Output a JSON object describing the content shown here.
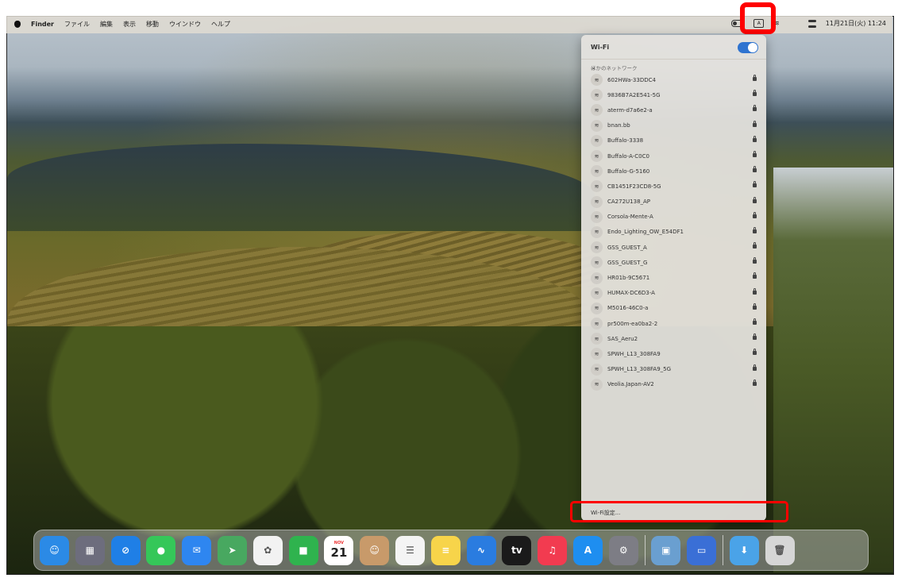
{
  "menubar": {
    "app_name": "Finder",
    "menus": [
      "ファイル",
      "編集",
      "表示",
      "移動",
      "ウインドウ",
      "ヘルプ"
    ],
    "input_indicator": "A",
    "datetime": "11月21日(火) 11:24"
  },
  "wifi_panel": {
    "title": "Wi-Fi",
    "toggle_on": true,
    "section_label": "ほかのネットワーク",
    "networks": [
      "602HWa-33DDC4",
      "9836B7A2E541-5G",
      "aterm-d7a6e2-a",
      "bnan.bb",
      "Buffalo-3338",
      "Buffalo-A-C0C0",
      "Buffalo-G-5160",
      "CB1451F23CD8-5G",
      "CA272U138_AP",
      "Corsola-Mente-A",
      "Endo_Lighting_OW_E54DF1",
      "GSS_GUEST_A",
      "GSS_GUEST_G",
      "HR01b-9C5671",
      "HUMAX-DC6D3-A",
      "M5016-46C0-a",
      "pr500m-ea0ba2-2",
      "SAS_Aeru2",
      "SPWH_L13_308FA9",
      "SPWH_L13_308FA9_5G",
      "Veolia.Japan-AV2"
    ],
    "settings_label": "Wi-Fi設定..."
  },
  "dock": {
    "apps": [
      {
        "name": "finder",
        "color": "#2b8ae6",
        "glyph": "☺"
      },
      {
        "name": "launchpad",
        "color": "#6d6d7d",
        "glyph": "▦"
      },
      {
        "name": "safari",
        "color": "#1f7fe6",
        "glyph": "⊘"
      },
      {
        "name": "messages",
        "color": "#35c759",
        "glyph": "●"
      },
      {
        "name": "mail",
        "color": "#2e86f0",
        "glyph": "✉"
      },
      {
        "name": "maps",
        "color": "#48a860",
        "glyph": "➤"
      },
      {
        "name": "photos",
        "color": "#f2f2f2",
        "glyph": "✿"
      },
      {
        "name": "facetime",
        "color": "#2fb34e",
        "glyph": "■"
      },
      {
        "name": "calendar",
        "color": "#ffffff",
        "glyph": "21",
        "month": "NOV"
      },
      {
        "name": "contacts",
        "color": "#c89a6a",
        "glyph": "☺"
      },
      {
        "name": "reminders",
        "color": "#f4f4f4",
        "glyph": "☰"
      },
      {
        "name": "notes",
        "color": "#f7d44a",
        "glyph": "≡"
      },
      {
        "name": "freeform",
        "color": "#2a7ce0",
        "glyph": "∿"
      },
      {
        "name": "apple-tv",
        "color": "#1a1a1a",
        "glyph": "tv"
      },
      {
        "name": "music",
        "color": "#f23b50",
        "glyph": "♫"
      },
      {
        "name": "app-store",
        "color": "#1e8ef0",
        "glyph": "A"
      },
      {
        "name": "system-settings",
        "color": "#7d7d85",
        "glyph": "⚙"
      },
      {
        "name": "preview",
        "color": "#6a9fd0",
        "glyph": "▣"
      },
      {
        "name": "screen-sharing",
        "color": "#3a6fd6",
        "glyph": "▭"
      },
      {
        "name": "downloads-folder",
        "color": "#4aa3e8",
        "glyph": "⬇"
      },
      {
        "name": "trash",
        "color": "#d6d6d6",
        "glyph": "🗑"
      }
    ]
  }
}
